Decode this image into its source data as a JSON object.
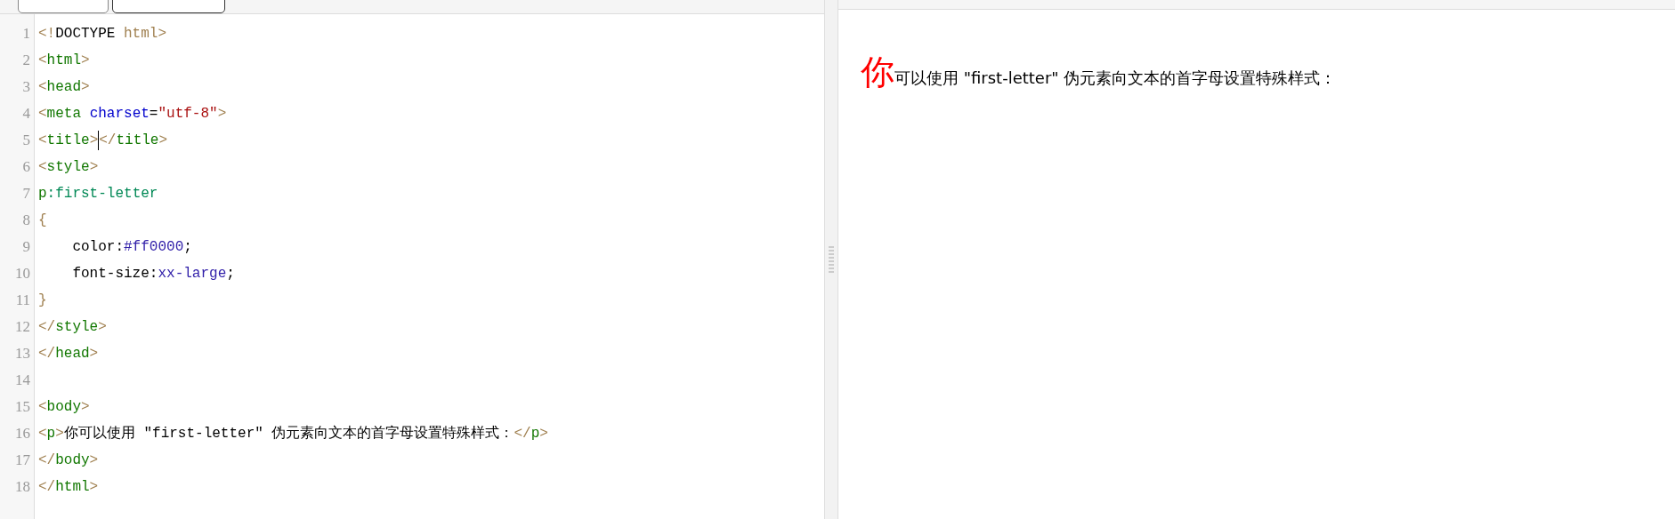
{
  "toolbar": {
    "buttons": [
      {
        "kind": "plain"
      },
      {
        "kind": "dark"
      }
    ]
  },
  "editor": {
    "lines": [
      {
        "number": "1",
        "tokens": [
          {
            "kind": "bracket",
            "text": "<!"
          },
          {
            "kind": "text",
            "text": "DOCTYPE "
          },
          {
            "kind": "bracket",
            "text": "html>"
          }
        ]
      },
      {
        "number": "2",
        "tokens": [
          {
            "kind": "bracket",
            "text": "<"
          },
          {
            "kind": "tag",
            "text": "html"
          },
          {
            "kind": "bracket",
            "text": ">"
          }
        ]
      },
      {
        "number": "3",
        "tokens": [
          {
            "kind": "bracket",
            "text": "<"
          },
          {
            "kind": "tag",
            "text": "head"
          },
          {
            "kind": "bracket",
            "text": ">"
          }
        ]
      },
      {
        "number": "4",
        "tokens": [
          {
            "kind": "bracket",
            "text": "<"
          },
          {
            "kind": "tag",
            "text": "meta "
          },
          {
            "kind": "attr",
            "text": "charset"
          },
          {
            "kind": "text",
            "text": "="
          },
          {
            "kind": "string",
            "text": "\"utf-8\""
          },
          {
            "kind": "bracket",
            "text": ">"
          }
        ]
      },
      {
        "number": "5",
        "tokens": [
          {
            "kind": "bracket",
            "text": "<"
          },
          {
            "kind": "tag",
            "text": "title"
          },
          {
            "kind": "bracket",
            "text": ">"
          },
          {
            "kind": "cursor"
          },
          {
            "kind": "bracket",
            "text": "</"
          },
          {
            "kind": "tag",
            "text": "title"
          },
          {
            "kind": "bracket",
            "text": ">"
          }
        ]
      },
      {
        "number": "6",
        "tokens": [
          {
            "kind": "bracket",
            "text": "<"
          },
          {
            "kind": "tag",
            "text": "style"
          },
          {
            "kind": "bracket",
            "text": ">"
          }
        ]
      },
      {
        "number": "7",
        "tokens": [
          {
            "kind": "tag",
            "text": "p"
          },
          {
            "kind": "selector",
            "text": ":first-letter"
          }
        ]
      },
      {
        "number": "8",
        "tokens": [
          {
            "kind": "bracket",
            "text": "{"
          }
        ]
      },
      {
        "number": "9",
        "tokens": [
          {
            "kind": "text",
            "text": "    color:"
          },
          {
            "kind": "value",
            "text": "#ff0000"
          },
          {
            "kind": "text",
            "text": ";"
          }
        ]
      },
      {
        "number": "10",
        "tokens": [
          {
            "kind": "text",
            "text": "    font-size:"
          },
          {
            "kind": "value",
            "text": "xx-large"
          },
          {
            "kind": "text",
            "text": ";"
          }
        ]
      },
      {
        "number": "11",
        "tokens": [
          {
            "kind": "bracket",
            "text": "}"
          }
        ]
      },
      {
        "number": "12",
        "tokens": [
          {
            "kind": "bracket",
            "text": "</"
          },
          {
            "kind": "tag",
            "text": "style"
          },
          {
            "kind": "bracket",
            "text": ">"
          }
        ]
      },
      {
        "number": "13",
        "tokens": [
          {
            "kind": "bracket",
            "text": "</"
          },
          {
            "kind": "tag",
            "text": "head"
          },
          {
            "kind": "bracket",
            "text": ">"
          }
        ]
      },
      {
        "number": "14"
      },
      {
        "number": "15",
        "tokens": [
          {
            "kind": "bracket",
            "text": "<"
          },
          {
            "kind": "tag",
            "text": "body"
          },
          {
            "kind": "bracket",
            "text": ">"
          }
        ]
      },
      {
        "number": "16",
        "tokens": [
          {
            "kind": "bracket",
            "text": "<"
          },
          {
            "kind": "tag",
            "text": "p"
          },
          {
            "kind": "bracket",
            "text": ">"
          },
          {
            "kind": "text",
            "text": "你可以使用 \"first-letter\" 伪元素向文本的首字母设置特殊样式："
          },
          {
            "kind": "bracket",
            "text": "</"
          },
          {
            "kind": "tag",
            "text": "p"
          },
          {
            "kind": "bracket",
            "text": ">"
          }
        ]
      },
      {
        "number": "17",
        "tokens": [
          {
            "kind": "bracket",
            "text": "</"
          },
          {
            "kind": "tag",
            "text": "body"
          },
          {
            "kind": "bracket",
            "text": ">"
          }
        ]
      },
      {
        "number": "18",
        "tokens": [
          {
            "kind": "bracket",
            "text": "</"
          },
          {
            "kind": "tag",
            "text": "html"
          },
          {
            "kind": "bracket",
            "text": ">"
          }
        ]
      }
    ]
  },
  "preview": {
    "first_letter": "你",
    "text": "可以使用 \"first-letter\" 伪元素向文本的首字母设置特殊样式："
  }
}
